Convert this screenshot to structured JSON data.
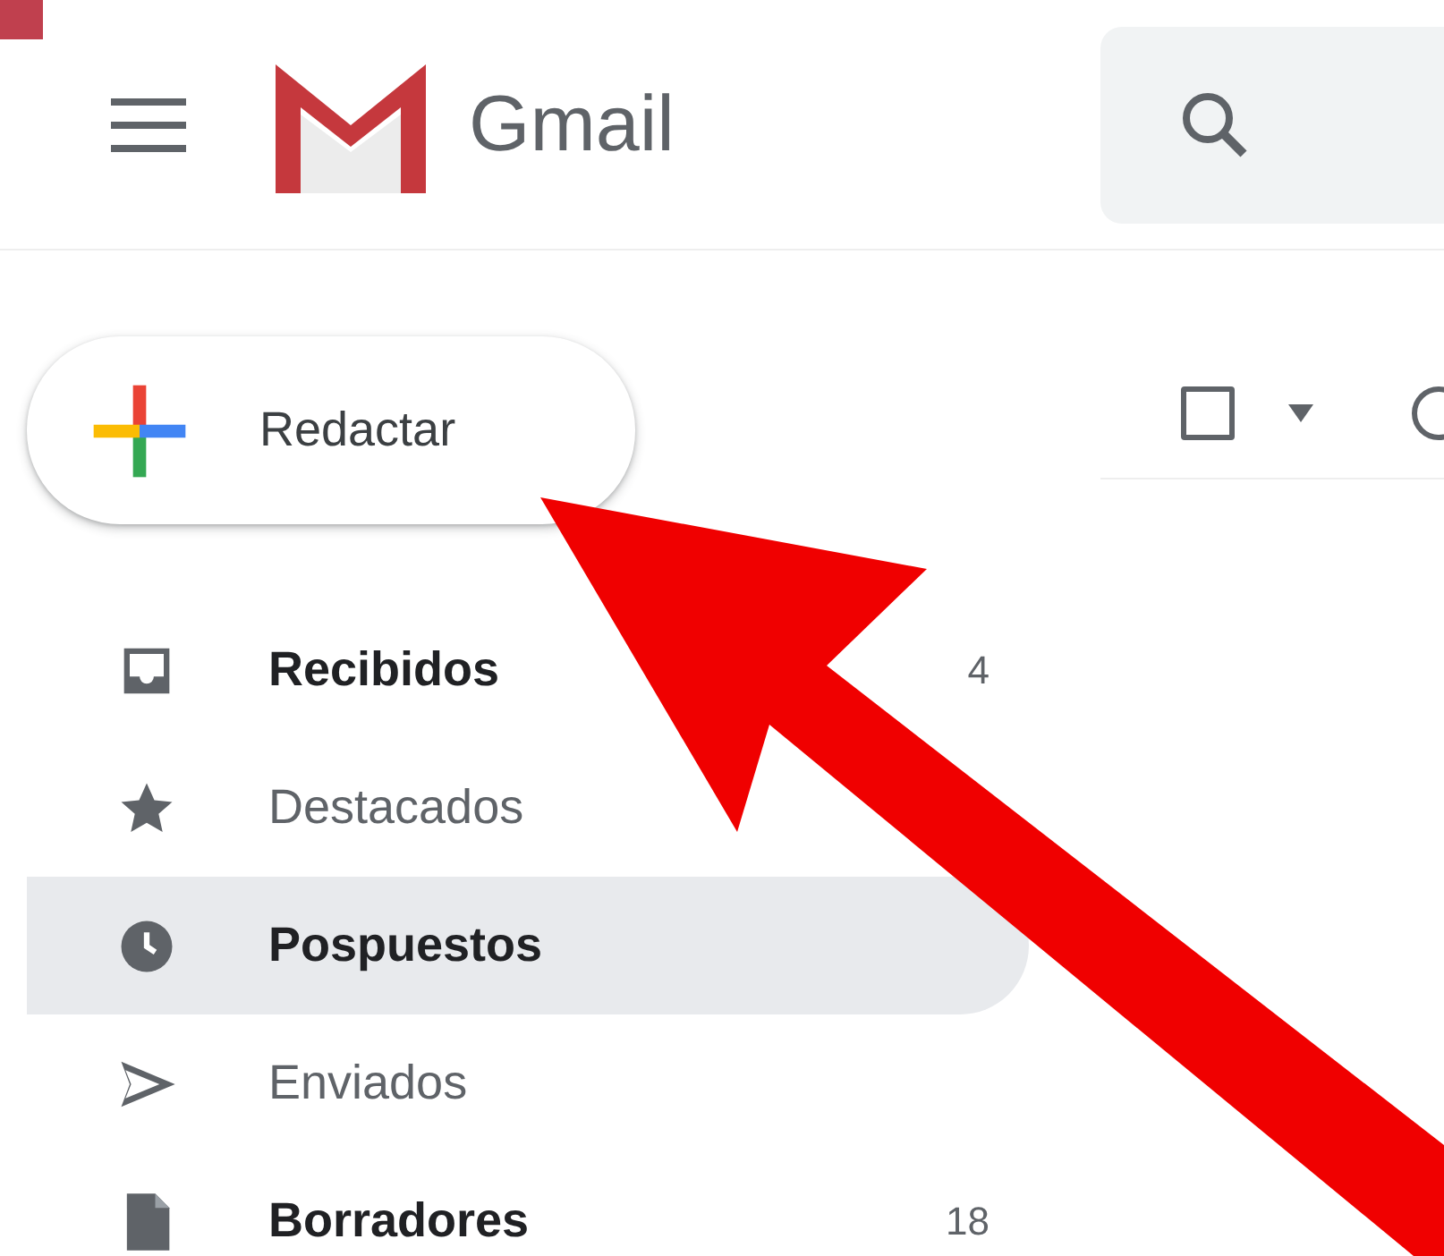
{
  "header": {
    "app_name": "Gmail"
  },
  "compose": {
    "label": "Redactar"
  },
  "toolbar": {
    "select_all": {
      "checked": false
    }
  },
  "nav": [
    {
      "label": "Recibidos",
      "count": "4",
      "unread": true,
      "selected": false
    },
    {
      "label": "Destacados",
      "unread": false,
      "selected": false
    },
    {
      "label": "Pospuestos",
      "unread": true,
      "selected": true
    },
    {
      "label": "Enviados",
      "unread": false,
      "selected": false
    },
    {
      "label": "Borradores",
      "count": "18",
      "unread": true,
      "selected": false
    }
  ]
}
